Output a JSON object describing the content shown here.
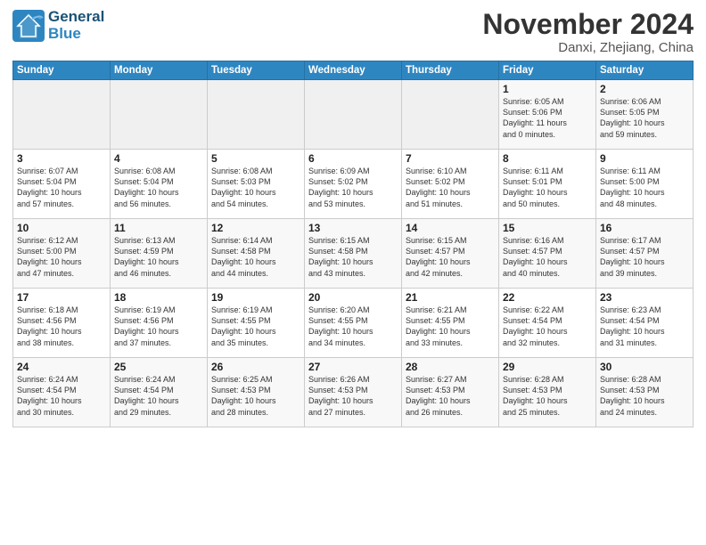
{
  "header": {
    "logo_line1": "General",
    "logo_line2": "Blue",
    "month": "November 2024",
    "location": "Danxi, Zhejiang, China"
  },
  "weekdays": [
    "Sunday",
    "Monday",
    "Tuesday",
    "Wednesday",
    "Thursday",
    "Friday",
    "Saturday"
  ],
  "weeks": [
    [
      {
        "day": "",
        "info": ""
      },
      {
        "day": "",
        "info": ""
      },
      {
        "day": "",
        "info": ""
      },
      {
        "day": "",
        "info": ""
      },
      {
        "day": "",
        "info": ""
      },
      {
        "day": "1",
        "info": "Sunrise: 6:05 AM\nSunset: 5:06 PM\nDaylight: 11 hours\nand 0 minutes."
      },
      {
        "day": "2",
        "info": "Sunrise: 6:06 AM\nSunset: 5:05 PM\nDaylight: 10 hours\nand 59 minutes."
      }
    ],
    [
      {
        "day": "3",
        "info": "Sunrise: 6:07 AM\nSunset: 5:04 PM\nDaylight: 10 hours\nand 57 minutes."
      },
      {
        "day": "4",
        "info": "Sunrise: 6:08 AM\nSunset: 5:04 PM\nDaylight: 10 hours\nand 56 minutes."
      },
      {
        "day": "5",
        "info": "Sunrise: 6:08 AM\nSunset: 5:03 PM\nDaylight: 10 hours\nand 54 minutes."
      },
      {
        "day": "6",
        "info": "Sunrise: 6:09 AM\nSunset: 5:02 PM\nDaylight: 10 hours\nand 53 minutes."
      },
      {
        "day": "7",
        "info": "Sunrise: 6:10 AM\nSunset: 5:02 PM\nDaylight: 10 hours\nand 51 minutes."
      },
      {
        "day": "8",
        "info": "Sunrise: 6:11 AM\nSunset: 5:01 PM\nDaylight: 10 hours\nand 50 minutes."
      },
      {
        "day": "9",
        "info": "Sunrise: 6:11 AM\nSunset: 5:00 PM\nDaylight: 10 hours\nand 48 minutes."
      }
    ],
    [
      {
        "day": "10",
        "info": "Sunrise: 6:12 AM\nSunset: 5:00 PM\nDaylight: 10 hours\nand 47 minutes."
      },
      {
        "day": "11",
        "info": "Sunrise: 6:13 AM\nSunset: 4:59 PM\nDaylight: 10 hours\nand 46 minutes."
      },
      {
        "day": "12",
        "info": "Sunrise: 6:14 AM\nSunset: 4:58 PM\nDaylight: 10 hours\nand 44 minutes."
      },
      {
        "day": "13",
        "info": "Sunrise: 6:15 AM\nSunset: 4:58 PM\nDaylight: 10 hours\nand 43 minutes."
      },
      {
        "day": "14",
        "info": "Sunrise: 6:15 AM\nSunset: 4:57 PM\nDaylight: 10 hours\nand 42 minutes."
      },
      {
        "day": "15",
        "info": "Sunrise: 6:16 AM\nSunset: 4:57 PM\nDaylight: 10 hours\nand 40 minutes."
      },
      {
        "day": "16",
        "info": "Sunrise: 6:17 AM\nSunset: 4:57 PM\nDaylight: 10 hours\nand 39 minutes."
      }
    ],
    [
      {
        "day": "17",
        "info": "Sunrise: 6:18 AM\nSunset: 4:56 PM\nDaylight: 10 hours\nand 38 minutes."
      },
      {
        "day": "18",
        "info": "Sunrise: 6:19 AM\nSunset: 4:56 PM\nDaylight: 10 hours\nand 37 minutes."
      },
      {
        "day": "19",
        "info": "Sunrise: 6:19 AM\nSunset: 4:55 PM\nDaylight: 10 hours\nand 35 minutes."
      },
      {
        "day": "20",
        "info": "Sunrise: 6:20 AM\nSunset: 4:55 PM\nDaylight: 10 hours\nand 34 minutes."
      },
      {
        "day": "21",
        "info": "Sunrise: 6:21 AM\nSunset: 4:55 PM\nDaylight: 10 hours\nand 33 minutes."
      },
      {
        "day": "22",
        "info": "Sunrise: 6:22 AM\nSunset: 4:54 PM\nDaylight: 10 hours\nand 32 minutes."
      },
      {
        "day": "23",
        "info": "Sunrise: 6:23 AM\nSunset: 4:54 PM\nDaylight: 10 hours\nand 31 minutes."
      }
    ],
    [
      {
        "day": "24",
        "info": "Sunrise: 6:24 AM\nSunset: 4:54 PM\nDaylight: 10 hours\nand 30 minutes."
      },
      {
        "day": "25",
        "info": "Sunrise: 6:24 AM\nSunset: 4:54 PM\nDaylight: 10 hours\nand 29 minutes."
      },
      {
        "day": "26",
        "info": "Sunrise: 6:25 AM\nSunset: 4:53 PM\nDaylight: 10 hours\nand 28 minutes."
      },
      {
        "day": "27",
        "info": "Sunrise: 6:26 AM\nSunset: 4:53 PM\nDaylight: 10 hours\nand 27 minutes."
      },
      {
        "day": "28",
        "info": "Sunrise: 6:27 AM\nSunset: 4:53 PM\nDaylight: 10 hours\nand 26 minutes."
      },
      {
        "day": "29",
        "info": "Sunrise: 6:28 AM\nSunset: 4:53 PM\nDaylight: 10 hours\nand 25 minutes."
      },
      {
        "day": "30",
        "info": "Sunrise: 6:28 AM\nSunset: 4:53 PM\nDaylight: 10 hours\nand 24 minutes."
      }
    ]
  ]
}
